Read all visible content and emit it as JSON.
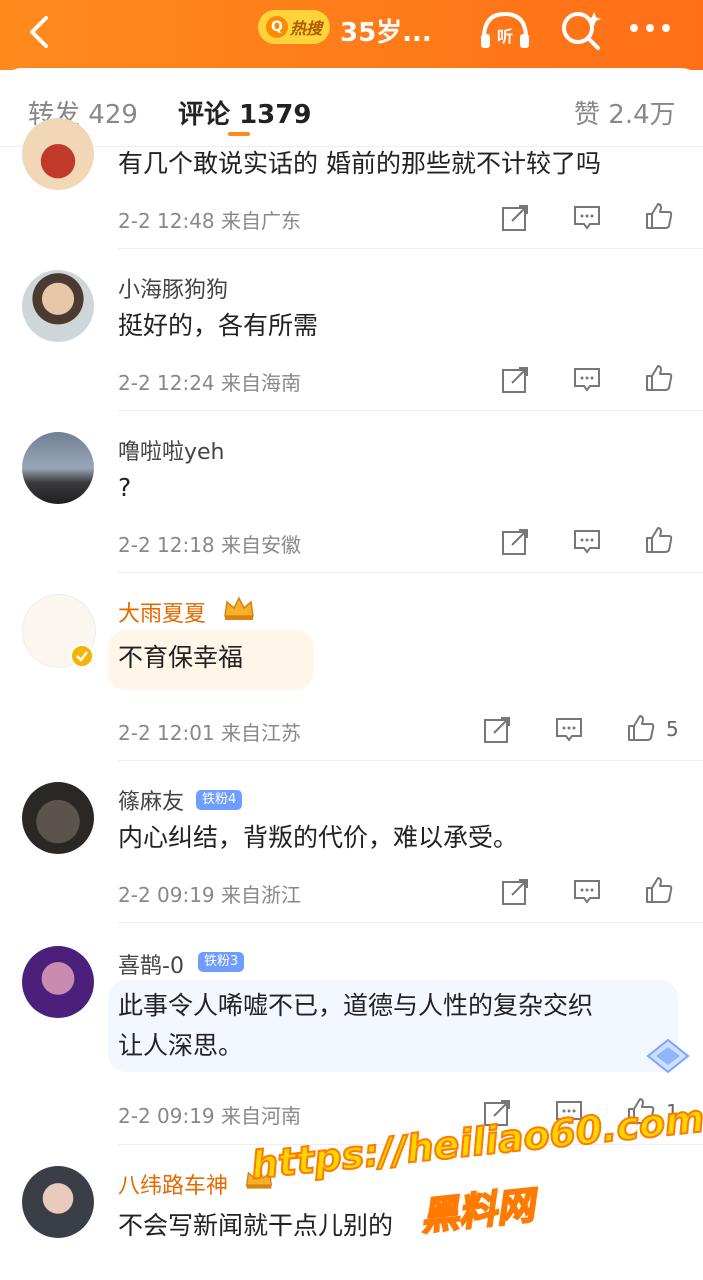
{
  "topbar": {
    "hot_badge": "热搜",
    "title": "35岁..."
  },
  "tabs": {
    "repost_label": "转发",
    "repost_count": "429",
    "comment_label": "评论",
    "comment_count": "1379",
    "like_label": "赞",
    "like_count": "2.4万"
  },
  "comments": [
    {
      "name": "",
      "text": "有几个敢说实话的  婚前的那些就不计较了吗",
      "time": "2-2 12:48",
      "loc": "来自广东",
      "likes": ""
    },
    {
      "name": "小海豚狗狗",
      "text": "挺好的，各有所需",
      "time": "2-2 12:24",
      "loc": "来自海南",
      "likes": ""
    },
    {
      "name": "噜啦啦yeh",
      "text": "?",
      "time": "2-2 12:18",
      "loc": "来自安徽",
      "likes": ""
    },
    {
      "name": "大雨夏夏",
      "text": "不育保幸福",
      "time": "2-2 12:01",
      "loc": "来自江苏",
      "likes": "5"
    },
    {
      "name": "篠麻友",
      "badge": "铁粉4",
      "text": "内心纠结，背叛的代价，难以承受。",
      "time": "2-2 09:19",
      "loc": "来自浙江",
      "likes": ""
    },
    {
      "name": "喜鹊-0",
      "badge": "铁粉3",
      "text_l1": "此事令人唏嘘不已，道德与人性的复杂交织",
      "text_l2": "让人深思。",
      "time": "2-2 09:19",
      "loc": "来自河南",
      "likes": "1"
    },
    {
      "name": "八纬路车神",
      "text": "不会写新闻就干点儿别的",
      "time": "",
      "loc": "",
      "likes": ""
    }
  ],
  "watermark": {
    "url": "https://heiliao60.com",
    "name": "黑料网"
  },
  "colors": {
    "accent": "#ff8a1c",
    "vip_name": "#e66a00",
    "text": "#222222",
    "meta": "#888888"
  },
  "icons": [
    "back-icon",
    "listen-icon",
    "search-icon",
    "more-icon",
    "share-icon",
    "comment-icon",
    "like-icon"
  ]
}
